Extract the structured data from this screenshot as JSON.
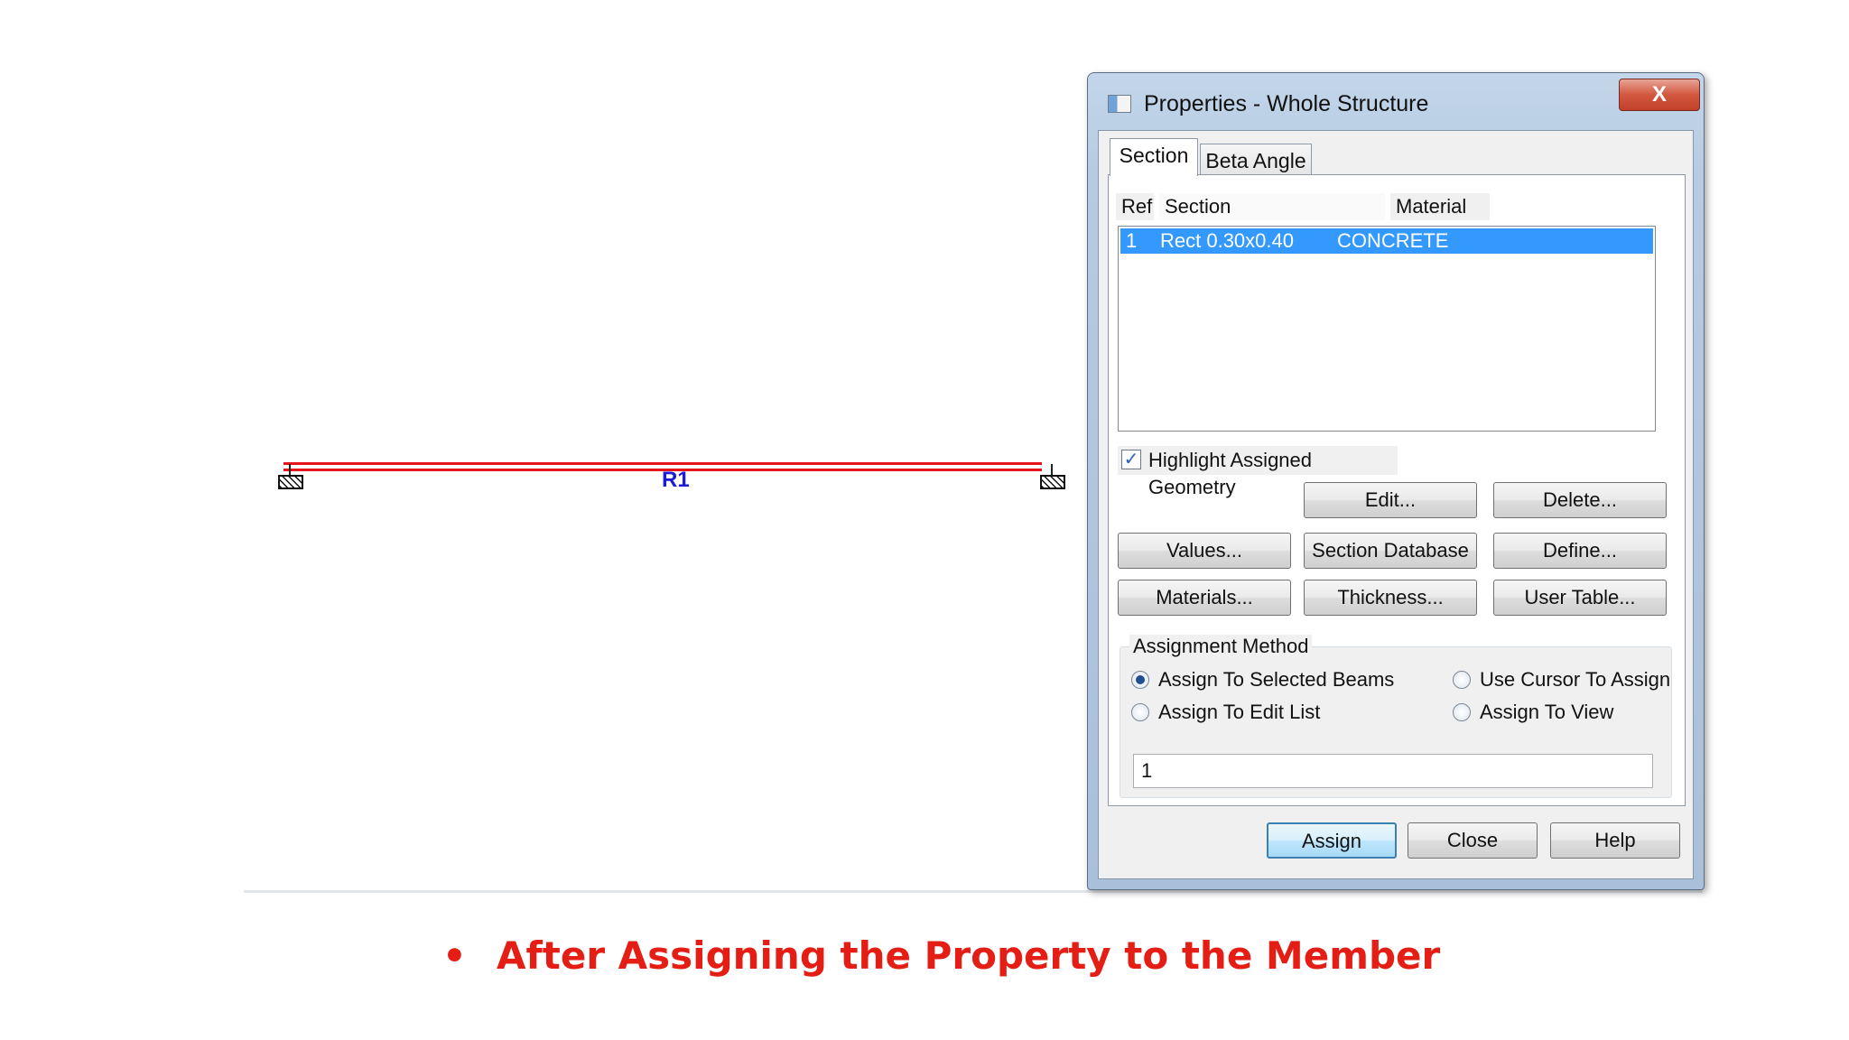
{
  "canvas": {
    "member_label": "R1",
    "member_color": "#e8141b",
    "label_color": "#1b1bd8"
  },
  "dialog": {
    "title": "Properties - Whole Structure",
    "close_label": "X",
    "tabs": [
      {
        "label": "Section",
        "active": true
      },
      {
        "label": "Beta Angle",
        "active": false
      }
    ],
    "columns": {
      "ref": "Ref",
      "section": "Section",
      "material": "Material"
    },
    "rows": [
      {
        "ref": "1",
        "section": "Rect 0.30x0.40",
        "material": "CONCRETE",
        "selected": true
      }
    ],
    "highlight_checkbox": {
      "label": "Highlight Assigned Geometry",
      "checked": true
    },
    "buttons": {
      "edit": "Edit...",
      "delete": "Delete...",
      "values": "Values...",
      "section_database": "Section Database",
      "define": "Define...",
      "materials": "Materials...",
      "thickness": "Thickness...",
      "user_table": "User Table..."
    },
    "assignment_method": {
      "legend": "Assignment Method",
      "options": [
        {
          "label": "Assign To Selected Beams",
          "selected": true
        },
        {
          "label": "Use Cursor To Assign",
          "selected": false
        },
        {
          "label": "Assign To Edit List",
          "selected": false
        },
        {
          "label": "Assign To View",
          "selected": false
        }
      ],
      "edit_list_value": "1"
    },
    "footer": {
      "assign": "Assign",
      "close": "Close",
      "help": "Help"
    },
    "selection_color": "#3399ff"
  },
  "caption": {
    "bullet": "•",
    "text": "After Assigning the Property to the Member",
    "color": "#e41e14"
  }
}
